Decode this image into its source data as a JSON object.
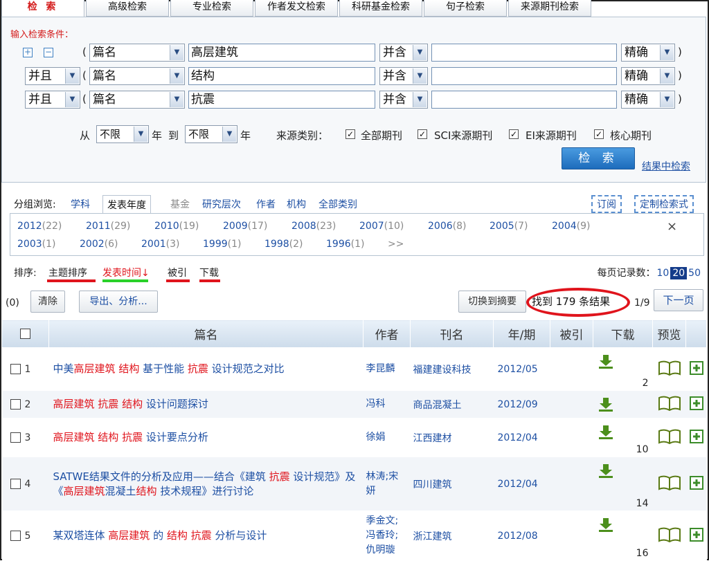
{
  "tabs": [
    "检 索",
    "高级检索",
    "专业检索",
    "作者发文检索",
    "科研基金检索",
    "句子检索",
    "来源期刊检索"
  ],
  "search": {
    "hint": "输入检索条件：",
    "plus": "+",
    "minus": "−",
    "open_paren": "(",
    "close_paren": ")",
    "rows": [
      {
        "logic": "",
        "field": "篇名",
        "term": "高层建筑",
        "combine": "并含",
        "term2": "",
        "match": "精确"
      },
      {
        "logic": "并且",
        "field": "篇名",
        "term": "结构",
        "combine": "并含",
        "term2": "",
        "match": "精确"
      },
      {
        "logic": "并且",
        "field": "篇名",
        "term": "抗震",
        "combine": "并含",
        "term2": "",
        "match": "精确"
      }
    ],
    "from_label": "从",
    "from_value": "不限",
    "year_label": "年",
    "to_label": "到",
    "to_value": "不限",
    "year_label2": "年",
    "source_label": "来源类别：",
    "sources": [
      "全部期刊",
      "SCI来源期刊",
      "EI来源期刊",
      "核心期刊"
    ],
    "check_mark": "✓",
    "search_button": "检 索",
    "within_results": "结果中检索"
  },
  "group": {
    "label": "分组浏览:",
    "tabs": [
      "学科",
      "发表年度",
      "基金",
      "研究层次",
      "作者",
      "机构",
      "全部类别"
    ],
    "subscribe": "订阅",
    "custom": "定制检索式",
    "close": "×",
    "more": ">>",
    "years": [
      {
        "y": "2012",
        "c": "(22)"
      },
      {
        "y": "2011",
        "c": "(29)"
      },
      {
        "y": "2010",
        "c": "(19)"
      },
      {
        "y": "2009",
        "c": "(17)"
      },
      {
        "y": "2008",
        "c": "(23)"
      },
      {
        "y": "2007",
        "c": "(10)"
      },
      {
        "y": "2006",
        "c": "(8)"
      },
      {
        "y": "2005",
        "c": "(7)"
      },
      {
        "y": "2004",
        "c": "(9)"
      },
      {
        "y": "2003",
        "c": "(1)"
      },
      {
        "y": "2002",
        "c": "(6)"
      },
      {
        "y": "2001",
        "c": "(3)"
      },
      {
        "y": "1999",
        "c": "(1)"
      },
      {
        "y": "1998",
        "c": "(2)"
      },
      {
        "y": "1996",
        "c": "(1)"
      }
    ]
  },
  "sort": {
    "label": "排序:",
    "items": [
      "主题排序",
      "发表时间↓",
      "被引",
      "下载"
    ],
    "perpage_label": "每页记录数：",
    "perpage": [
      "10",
      "20",
      "50"
    ],
    "perpage_current": "20"
  },
  "actions": {
    "selected_count": "(0)",
    "clear": "清除",
    "export": "导出、分析...",
    "switch": "切换到摘要",
    "found": "找到 179 条结果",
    "page": "1/9",
    "next": "下一页"
  },
  "table": {
    "headers": [
      "篇名",
      "作者",
      "刊名",
      "年/期",
      "被引",
      "下载",
      "预览"
    ],
    "rows": [
      {
        "n": "1",
        "title": [
          [
            "中美",
            ""
          ],
          [
            "高层建筑",
            "hl"
          ],
          [
            " ",
            ""
          ],
          [
            "结构",
            "hl"
          ],
          [
            " 基于性能 ",
            ""
          ],
          [
            "抗震",
            "hl"
          ],
          [
            " 设计规范之对比",
            ""
          ]
        ],
        "author": "李昆麟",
        "journal": "福建建设科技",
        "issue": "2012/05",
        "cited": "",
        "downloads": "2"
      },
      {
        "n": "2",
        "title": [
          [
            "高层建筑",
            "hl"
          ],
          [
            " ",
            ""
          ],
          [
            "抗震",
            "hl"
          ],
          [
            " ",
            ""
          ],
          [
            "结构",
            "hl"
          ],
          [
            " 设计问题探讨",
            ""
          ]
        ],
        "author": "冯科",
        "journal": "商品混凝土",
        "issue": "2012/09",
        "cited": "",
        "downloads": ""
      },
      {
        "n": "3",
        "title": [
          [
            "高层建筑",
            "hl"
          ],
          [
            " ",
            ""
          ],
          [
            "结构",
            "hl"
          ],
          [
            " ",
            ""
          ],
          [
            "抗震",
            "hl"
          ],
          [
            " 设计要点分析",
            ""
          ]
        ],
        "author": "徐娟",
        "journal": "江西建材",
        "issue": "2012/04",
        "cited": "",
        "downloads": "10"
      },
      {
        "n": "4",
        "title": [
          [
            "SATWE结果文件的分析及应用——结合《建筑 ",
            ""
          ],
          [
            "抗震",
            "hl"
          ],
          [
            " 设计规范》及《",
            ""
          ],
          [
            "高层建筑",
            "hl"
          ],
          [
            "混凝土",
            ""
          ],
          [
            "结构",
            "hl"
          ],
          [
            " 技术规程》进行讨论",
            ""
          ]
        ],
        "author": "林涛;宋妍",
        "journal": "四川建筑",
        "issue": "2012/04",
        "cited": "",
        "downloads": "14"
      },
      {
        "n": "5",
        "title": [
          [
            "某双塔连体 ",
            ""
          ],
          [
            "高层建筑",
            "hl"
          ],
          [
            " 的 ",
            ""
          ],
          [
            "结构",
            "hl"
          ],
          [
            " ",
            ""
          ],
          [
            "抗震",
            "hl"
          ],
          [
            " 分析与设计",
            ""
          ]
        ],
        "author": "季金文;冯香玲;仇明璇",
        "journal": "浙江建筑",
        "issue": "2012/08",
        "cited": "",
        "downloads": "16"
      }
    ]
  },
  "colors": {
    "accent_red": "#e0141c",
    "link_blue": "#1d4fa3",
    "header_bg": "#cddceb",
    "button_blue": "#1d6cbc"
  },
  "icons": [
    "plus-icon",
    "minus-icon",
    "dropdown-arrow-icon",
    "checkbox-icon",
    "download-icon",
    "book-preview-icon",
    "add-icon",
    "close-icon"
  ]
}
